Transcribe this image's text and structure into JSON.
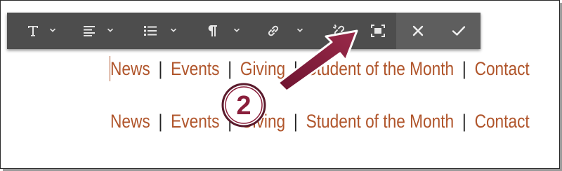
{
  "toolbar": {
    "buttons": [
      {
        "name": "text-format-button",
        "icon": "text-T-icon",
        "dropdown": true
      },
      {
        "name": "align-button",
        "icon": "align-left-icon",
        "dropdown": true
      },
      {
        "name": "list-button",
        "icon": "bulleted-list-icon",
        "dropdown": true
      },
      {
        "name": "paragraph-button",
        "icon": "pilcrow-icon",
        "dropdown": true
      },
      {
        "name": "link-button",
        "icon": "link-icon",
        "dropdown": true
      },
      {
        "name": "unlink-button",
        "icon": "unlink-icon",
        "dropdown": false
      },
      {
        "name": "fullscreen-button",
        "icon": "expand-frame-icon",
        "dropdown": false
      },
      {
        "name": "cancel-button",
        "icon": "close-x-icon",
        "dropdown": false
      },
      {
        "name": "confirm-button",
        "icon": "checkmark-icon",
        "dropdown": false
      }
    ],
    "colors": {
      "bar": "#4d4d4d",
      "right_group": "#5e5e5e",
      "icon": "#e6e6e6"
    }
  },
  "nav_editing": {
    "items": [
      "News",
      "Events",
      "Giving",
      "Student of the Month",
      "Contact"
    ],
    "separator": "|"
  },
  "nav_preview": {
    "items": [
      "News",
      "Events",
      "Giving",
      "Student of the Month",
      "Contact"
    ],
    "separator": "|"
  },
  "annotation": {
    "step_number": "2",
    "arrow_color": "#7b1e3c",
    "badge_color": "#8a1f3b"
  },
  "link_color": "#b0552b"
}
